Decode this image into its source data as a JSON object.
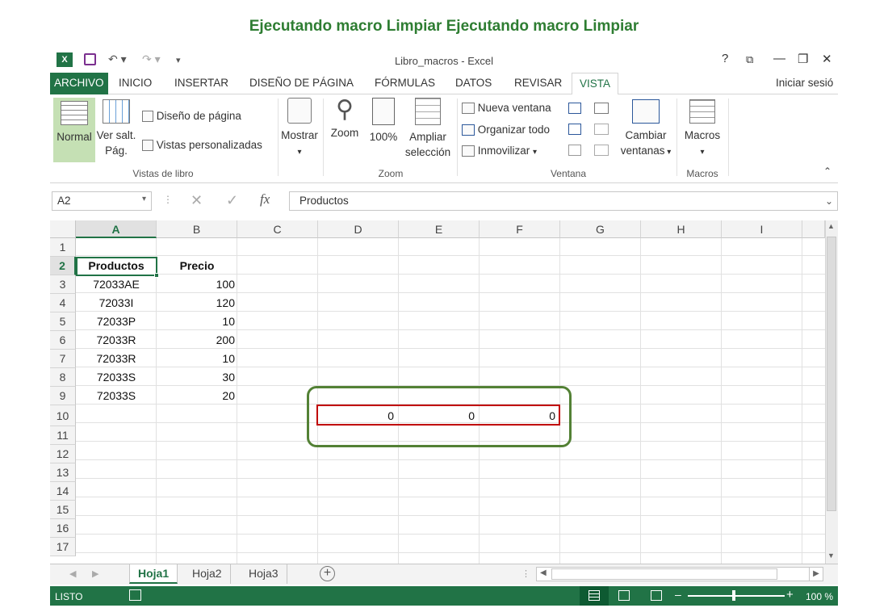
{
  "slide_title": "Ejecutando macro Limpiar Ejecutando macro Limpiar",
  "window": {
    "title": "Libro_macros - Excel",
    "help": "?",
    "signin": "Iniciar sesió"
  },
  "tabs": [
    "ARCHIVO",
    "INICIO",
    "INSERTAR",
    "DISEÑO DE PÁGINA",
    "FÓRMULAS",
    "DATOS",
    "REVISAR",
    "VISTA"
  ],
  "active_tab": "VISTA",
  "ribbon": {
    "normal": "Normal",
    "ver_salt_1": "Ver salt.",
    "ver_salt_2": "Pág.",
    "diseno_pagina": "Diseño de página",
    "vistas_personalizadas": "Vistas personalizadas",
    "group_vistas": "Vistas de libro",
    "mostrar": "Mostrar",
    "zoom": "Zoom",
    "zoom100": "100%",
    "ampliar_1": "Ampliar",
    "ampliar_2": "selección",
    "group_zoom": "Zoom",
    "nueva_ventana": "Nueva ventana",
    "organizar_todo": "Organizar todo",
    "inmovilizar": "Inmovilizar",
    "cambiar_1": "Cambiar",
    "cambiar_2": "ventanas",
    "group_ventana": "Ventana",
    "macros": "Macros",
    "group_macros": "Macros"
  },
  "formula_bar": {
    "name_box": "A2",
    "fx": "fx",
    "content": "Productos"
  },
  "columns": [
    "A",
    "B",
    "C",
    "D",
    "E",
    "F",
    "G",
    "H",
    "I"
  ],
  "rows": [
    "1",
    "2",
    "3",
    "4",
    "5",
    "6",
    "7",
    "8",
    "9",
    "10",
    "11",
    "12",
    "13",
    "14",
    "15",
    "16",
    "17"
  ],
  "table": {
    "header": [
      "Productos",
      "Precio"
    ],
    "data": [
      [
        "72033AE",
        "100"
      ],
      [
        "72033I",
        "120"
      ],
      [
        "72033P",
        "10"
      ],
      [
        "72033R",
        "200"
      ],
      [
        "72033R",
        "10"
      ],
      [
        "72033S",
        "30"
      ],
      [
        "72033S",
        "20"
      ]
    ]
  },
  "row10": [
    "0",
    "0",
    "0"
  ],
  "sheets": [
    "Hoja1",
    "Hoja2",
    "Hoja3"
  ],
  "status": {
    "ready": "LISTO",
    "zoom": "100 %"
  },
  "colors": {
    "excel_green": "#217346",
    "highlight_green": "#538135",
    "highlight_red": "#c00000"
  }
}
